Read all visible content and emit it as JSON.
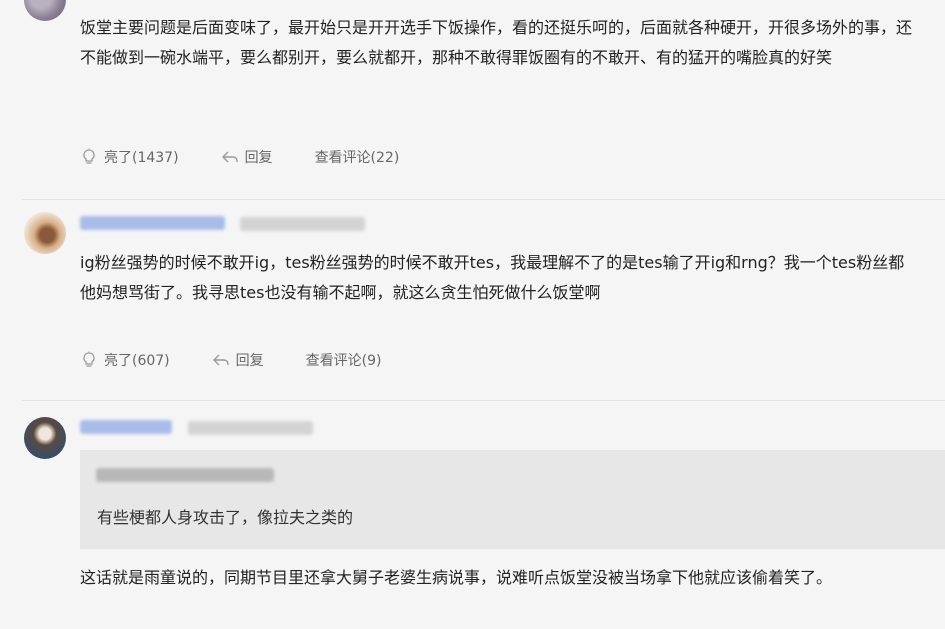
{
  "comments": [
    {
      "text": "饭堂主要问题是后面变味了，最开始只是开开选手下饭操作，看的还挺乐呵的，后面就各种硬开，开很多场外的事，还不能做到一碗水端平，要么都别开，要么就都开，那种不敢得罪饭圈有的不敢开、有的猛开的嘴脸真的好笑",
      "like_label": "亮了(1437)",
      "reply_label": "回复",
      "view_label": "查看评论(22)"
    },
    {
      "text": "ig粉丝强势的时候不敢开ig，tes粉丝强势的时候不敢开tes，我最理解不了的是tes输了开ig和rng？我一个tes粉丝都他妈想骂街了。我寻思tes也没有输不起啊，就这么贪生怕死做什么饭堂啊",
      "like_label": "亮了(607)",
      "reply_label": "回复",
      "view_label": "查看评论(9)"
    },
    {
      "quote_text": "有些梗都人身攻击了，像拉夫之类的",
      "text": "这话就是雨童说的，同期节目里还拿大舅子老婆生病说事，说难听点饭堂没被当场拿下他就应该偷着笑了。"
    }
  ],
  "colors": {
    "background": "#f5f5f6",
    "text": "#222222",
    "action_text": "#666666",
    "quote_bg": "#e7e7e7",
    "blurred_name": "#9fb4e0"
  },
  "icons": [
    "lightbulb-icon",
    "reply-arrow-icon"
  ]
}
